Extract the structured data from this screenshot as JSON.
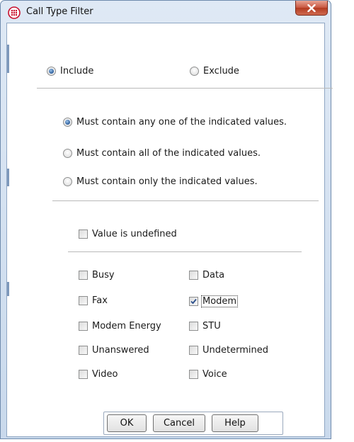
{
  "window": {
    "title": "Call Type Filter",
    "app_icon": "globe-network-icon",
    "close_icon": "close-x-icon",
    "close_color": "#c7553f"
  },
  "mode": {
    "include_label": "Include",
    "exclude_label": "Exclude",
    "selected": "include"
  },
  "match": {
    "options": [
      "Must contain any one of the indicated values.",
      "Must contain all of the indicated values.",
      "Must contain only the indicated values."
    ],
    "selected_index": 0
  },
  "undefined_label": "Value is undefined",
  "call_types": [
    {
      "label": "Busy",
      "checked": false
    },
    {
      "label": "Data",
      "checked": false
    },
    {
      "label": "Fax",
      "checked": false
    },
    {
      "label": "Modem",
      "checked": true
    },
    {
      "label": "Modem Energy",
      "checked": false
    },
    {
      "label": "STU",
      "checked": false
    },
    {
      "label": "Unanswered",
      "checked": false
    },
    {
      "label": "Undetermined",
      "checked": false
    },
    {
      "label": "Video",
      "checked": false
    },
    {
      "label": "Voice",
      "checked": false
    }
  ],
  "buttons": {
    "ok": "OK",
    "cancel": "Cancel",
    "help": "Help"
  }
}
